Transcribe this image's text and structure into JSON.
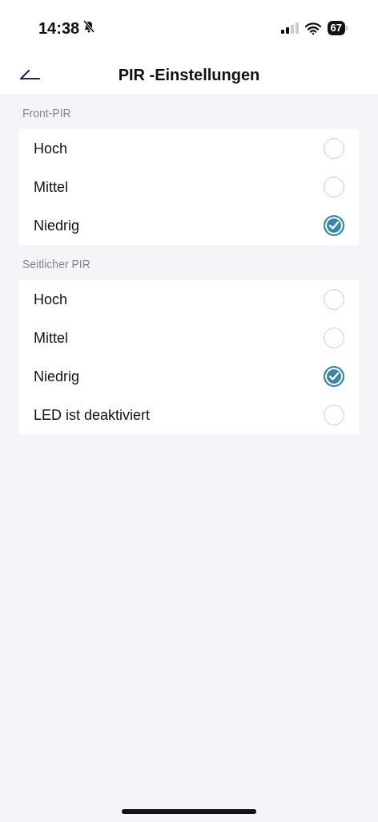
{
  "status_bar": {
    "time": "14:38",
    "silent": true,
    "battery": "67"
  },
  "header": {
    "title": "PIR -Einstellungen"
  },
  "sections": [
    {
      "title": "Front-PIR",
      "options": [
        {
          "label": "Hoch",
          "selected": false
        },
        {
          "label": "Mittel",
          "selected": false
        },
        {
          "label": "Niedrig",
          "selected": true
        }
      ]
    },
    {
      "title": "Seitlicher PIR",
      "options": [
        {
          "label": "Hoch",
          "selected": false
        },
        {
          "label": "Mittel",
          "selected": false
        },
        {
          "label": "Niedrig",
          "selected": true
        },
        {
          "label": "LED ist deaktiviert",
          "selected": false
        }
      ]
    }
  ]
}
